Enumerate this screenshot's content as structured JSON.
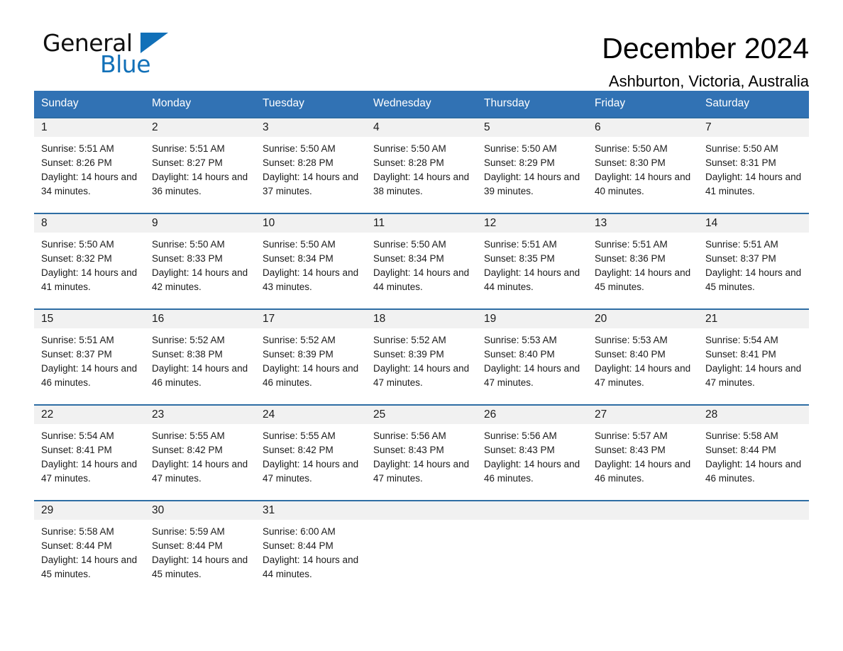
{
  "logo": {
    "word_general": "General",
    "word_blue": "Blue",
    "triangle_color": "#1170b8"
  },
  "header": {
    "month_title": "December 2024",
    "location": "Ashburton, Victoria, Australia"
  },
  "theme": {
    "header_blue": "#3172b4",
    "row_rule_blue": "#2e6da4",
    "daynum_band": "#f1f1f1"
  },
  "calendar": {
    "weekday_headers": [
      "Sunday",
      "Monday",
      "Tuesday",
      "Wednesday",
      "Thursday",
      "Friday",
      "Saturday"
    ],
    "weeks": [
      [
        {
          "day": "1",
          "sunrise": "Sunrise: 5:51 AM",
          "sunset": "Sunset: 8:26 PM",
          "daylight": "Daylight: 14 hours and 34 minutes."
        },
        {
          "day": "2",
          "sunrise": "Sunrise: 5:51 AM",
          "sunset": "Sunset: 8:27 PM",
          "daylight": "Daylight: 14 hours and 36 minutes."
        },
        {
          "day": "3",
          "sunrise": "Sunrise: 5:50 AM",
          "sunset": "Sunset: 8:28 PM",
          "daylight": "Daylight: 14 hours and 37 minutes."
        },
        {
          "day": "4",
          "sunrise": "Sunrise: 5:50 AM",
          "sunset": "Sunset: 8:28 PM",
          "daylight": "Daylight: 14 hours and 38 minutes."
        },
        {
          "day": "5",
          "sunrise": "Sunrise: 5:50 AM",
          "sunset": "Sunset: 8:29 PM",
          "daylight": "Daylight: 14 hours and 39 minutes."
        },
        {
          "day": "6",
          "sunrise": "Sunrise: 5:50 AM",
          "sunset": "Sunset: 8:30 PM",
          "daylight": "Daylight: 14 hours and 40 minutes."
        },
        {
          "day": "7",
          "sunrise": "Sunrise: 5:50 AM",
          "sunset": "Sunset: 8:31 PM",
          "daylight": "Daylight: 14 hours and 41 minutes."
        }
      ],
      [
        {
          "day": "8",
          "sunrise": "Sunrise: 5:50 AM",
          "sunset": "Sunset: 8:32 PM",
          "daylight": "Daylight: 14 hours and 41 minutes."
        },
        {
          "day": "9",
          "sunrise": "Sunrise: 5:50 AM",
          "sunset": "Sunset: 8:33 PM",
          "daylight": "Daylight: 14 hours and 42 minutes."
        },
        {
          "day": "10",
          "sunrise": "Sunrise: 5:50 AM",
          "sunset": "Sunset: 8:34 PM",
          "daylight": "Daylight: 14 hours and 43 minutes."
        },
        {
          "day": "11",
          "sunrise": "Sunrise: 5:50 AM",
          "sunset": "Sunset: 8:34 PM",
          "daylight": "Daylight: 14 hours and 44 minutes."
        },
        {
          "day": "12",
          "sunrise": "Sunrise: 5:51 AM",
          "sunset": "Sunset: 8:35 PM",
          "daylight": "Daylight: 14 hours and 44 minutes."
        },
        {
          "day": "13",
          "sunrise": "Sunrise: 5:51 AM",
          "sunset": "Sunset: 8:36 PM",
          "daylight": "Daylight: 14 hours and 45 minutes."
        },
        {
          "day": "14",
          "sunrise": "Sunrise: 5:51 AM",
          "sunset": "Sunset: 8:37 PM",
          "daylight": "Daylight: 14 hours and 45 minutes."
        }
      ],
      [
        {
          "day": "15",
          "sunrise": "Sunrise: 5:51 AM",
          "sunset": "Sunset: 8:37 PM",
          "daylight": "Daylight: 14 hours and 46 minutes."
        },
        {
          "day": "16",
          "sunrise": "Sunrise: 5:52 AM",
          "sunset": "Sunset: 8:38 PM",
          "daylight": "Daylight: 14 hours and 46 minutes."
        },
        {
          "day": "17",
          "sunrise": "Sunrise: 5:52 AM",
          "sunset": "Sunset: 8:39 PM",
          "daylight": "Daylight: 14 hours and 46 minutes."
        },
        {
          "day": "18",
          "sunrise": "Sunrise: 5:52 AM",
          "sunset": "Sunset: 8:39 PM",
          "daylight": "Daylight: 14 hours and 47 minutes."
        },
        {
          "day": "19",
          "sunrise": "Sunrise: 5:53 AM",
          "sunset": "Sunset: 8:40 PM",
          "daylight": "Daylight: 14 hours and 47 minutes."
        },
        {
          "day": "20",
          "sunrise": "Sunrise: 5:53 AM",
          "sunset": "Sunset: 8:40 PM",
          "daylight": "Daylight: 14 hours and 47 minutes."
        },
        {
          "day": "21",
          "sunrise": "Sunrise: 5:54 AM",
          "sunset": "Sunset: 8:41 PM",
          "daylight": "Daylight: 14 hours and 47 minutes."
        }
      ],
      [
        {
          "day": "22",
          "sunrise": "Sunrise: 5:54 AM",
          "sunset": "Sunset: 8:41 PM",
          "daylight": "Daylight: 14 hours and 47 minutes."
        },
        {
          "day": "23",
          "sunrise": "Sunrise: 5:55 AM",
          "sunset": "Sunset: 8:42 PM",
          "daylight": "Daylight: 14 hours and 47 minutes."
        },
        {
          "day": "24",
          "sunrise": "Sunrise: 5:55 AM",
          "sunset": "Sunset: 8:42 PM",
          "daylight": "Daylight: 14 hours and 47 minutes."
        },
        {
          "day": "25",
          "sunrise": "Sunrise: 5:56 AM",
          "sunset": "Sunset: 8:43 PM",
          "daylight": "Daylight: 14 hours and 47 minutes."
        },
        {
          "day": "26",
          "sunrise": "Sunrise: 5:56 AM",
          "sunset": "Sunset: 8:43 PM",
          "daylight": "Daylight: 14 hours and 46 minutes."
        },
        {
          "day": "27",
          "sunrise": "Sunrise: 5:57 AM",
          "sunset": "Sunset: 8:43 PM",
          "daylight": "Daylight: 14 hours and 46 minutes."
        },
        {
          "day": "28",
          "sunrise": "Sunrise: 5:58 AM",
          "sunset": "Sunset: 8:44 PM",
          "daylight": "Daylight: 14 hours and 46 minutes."
        }
      ],
      [
        {
          "day": "29",
          "sunrise": "Sunrise: 5:58 AM",
          "sunset": "Sunset: 8:44 PM",
          "daylight": "Daylight: 14 hours and 45 minutes."
        },
        {
          "day": "30",
          "sunrise": "Sunrise: 5:59 AM",
          "sunset": "Sunset: 8:44 PM",
          "daylight": "Daylight: 14 hours and 45 minutes."
        },
        {
          "day": "31",
          "sunrise": "Sunrise: 6:00 AM",
          "sunset": "Sunset: 8:44 PM",
          "daylight": "Daylight: 14 hours and 44 minutes."
        },
        {
          "day": "",
          "sunrise": "",
          "sunset": "",
          "daylight": ""
        },
        {
          "day": "",
          "sunrise": "",
          "sunset": "",
          "daylight": ""
        },
        {
          "day": "",
          "sunrise": "",
          "sunset": "",
          "daylight": ""
        },
        {
          "day": "",
          "sunrise": "",
          "sunset": "",
          "daylight": ""
        }
      ]
    ]
  }
}
